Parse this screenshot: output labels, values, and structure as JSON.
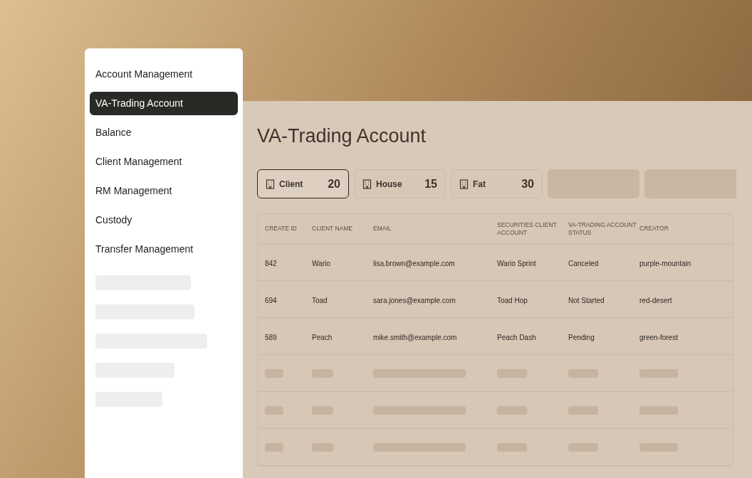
{
  "sidebar": {
    "items": [
      {
        "label": "Account Management",
        "selected": false
      },
      {
        "label": "VA-Trading Account",
        "selected": true
      },
      {
        "label": "Balance",
        "selected": false
      },
      {
        "label": "Client Management",
        "selected": false
      },
      {
        "label": "RM Management",
        "selected": false
      },
      {
        "label": "Custody",
        "selected": false
      },
      {
        "label": "Transfer Management",
        "selected": false
      }
    ]
  },
  "main": {
    "title": "VA-Trading Account",
    "tabs": [
      {
        "label": "Client",
        "count": "20",
        "selected": true
      },
      {
        "label": "House",
        "count": "15",
        "selected": false
      },
      {
        "label": "Fat",
        "count": "30",
        "selected": false
      }
    ],
    "table": {
      "columns": [
        "CREATE ID",
        "CLIENT NAME",
        "EMAIL",
        "SECURITIES CLIENT ACCOUNT",
        "VA-TRADING ACCOUNT STATUS",
        "CREATOR"
      ],
      "rows": [
        [
          "842",
          "Wario",
          "lisa.brown@example.com",
          "Wario Sprint",
          "Canceled",
          "purple-mountain"
        ],
        [
          "694",
          "Toad",
          "sara.jones@example.com",
          "Toad Hop",
          "Not Started",
          "red-desert"
        ],
        [
          "589",
          "Peach",
          "mike.smith@example.com",
          "Peach Dash",
          "Pending",
          "green-forest"
        ]
      ]
    }
  }
}
